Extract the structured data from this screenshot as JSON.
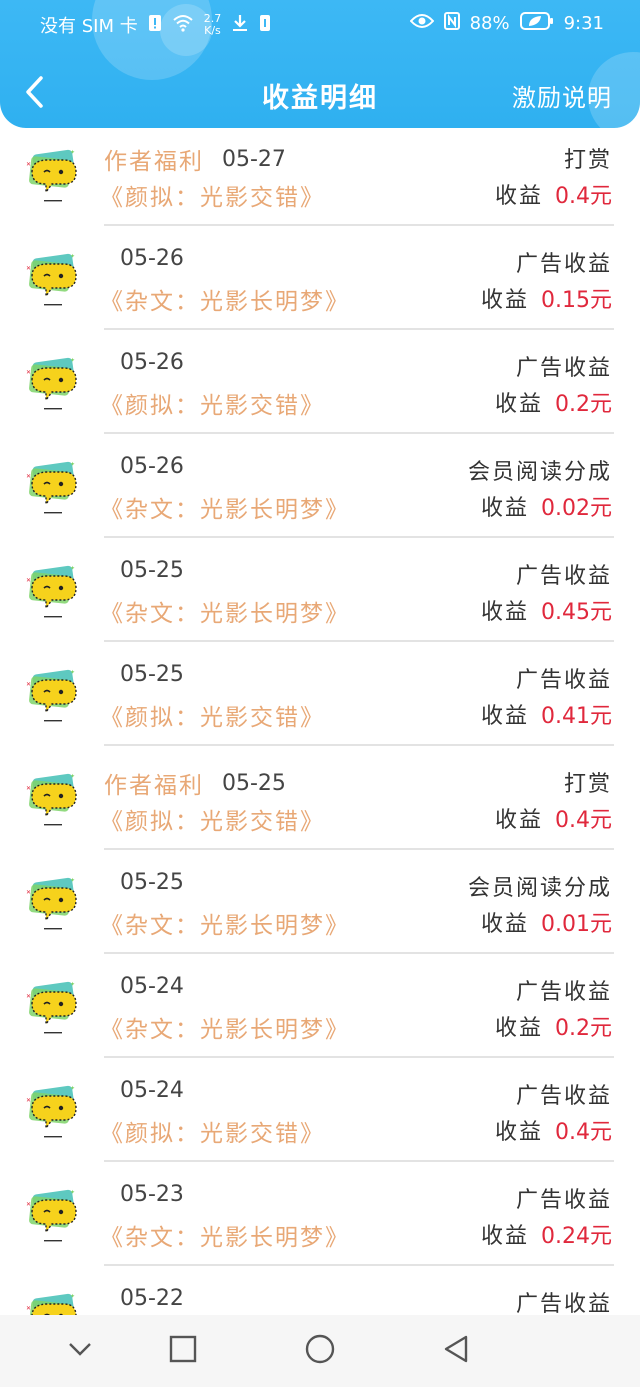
{
  "status_bar": {
    "carrier": "没有 SIM 卡",
    "speed_value": "2.7",
    "speed_unit": "K/s",
    "battery": "88%",
    "time": "9:31"
  },
  "header": {
    "title": "收益明细",
    "explain_label": "激励说明"
  },
  "earn_prefix": "收益",
  "records": [
    {
      "welfare": "作者福利",
      "date": "05-27",
      "book": "《颜拟：光影交错》",
      "type": "打赏",
      "amount": "0.4元"
    },
    {
      "welfare": "",
      "date": "05-26",
      "book": "《杂文：光影长明梦》",
      "type": "广告收益",
      "amount": "0.15元"
    },
    {
      "welfare": "",
      "date": "05-26",
      "book": "《颜拟：光影交错》",
      "type": "广告收益",
      "amount": "0.2元"
    },
    {
      "welfare": "",
      "date": "05-26",
      "book": "《杂文：光影长明梦》",
      "type": "会员阅读分成",
      "amount": "0.02元"
    },
    {
      "welfare": "",
      "date": "05-25",
      "book": "《杂文：光影长明梦》",
      "type": "广告收益",
      "amount": "0.45元"
    },
    {
      "welfare": "",
      "date": "05-25",
      "book": "《颜拟：光影交错》",
      "type": "广告收益",
      "amount": "0.41元"
    },
    {
      "welfare": "作者福利",
      "date": "05-25",
      "book": "《颜拟：光影交错》",
      "type": "打赏",
      "amount": "0.4元"
    },
    {
      "welfare": "",
      "date": "05-25",
      "book": "《杂文：光影长明梦》",
      "type": "会员阅读分成",
      "amount": "0.01元"
    },
    {
      "welfare": "",
      "date": "05-24",
      "book": "《杂文：光影长明梦》",
      "type": "广告收益",
      "amount": "0.2元"
    },
    {
      "welfare": "",
      "date": "05-24",
      "book": "《颜拟：光影交错》",
      "type": "广告收益",
      "amount": "0.4元"
    },
    {
      "welfare": "",
      "date": "05-23",
      "book": "《杂文：光影长明梦》",
      "type": "广告收益",
      "amount": "0.24元"
    },
    {
      "welfare": "",
      "date": "05-22",
      "book": "",
      "type": "广告收益",
      "amount": ""
    }
  ],
  "icons": {
    "back": "back-arrow-icon",
    "avatar": "yellow-chat-bubble-avatar-icon",
    "nav_down": "chevron-down-icon",
    "nav_recent": "square-icon",
    "nav_home": "circle-icon",
    "nav_back": "triangle-back-icon"
  },
  "colors": {
    "header_bg": "#3db8f5",
    "book_title": "#e8a876",
    "amount": "#e0283c"
  }
}
